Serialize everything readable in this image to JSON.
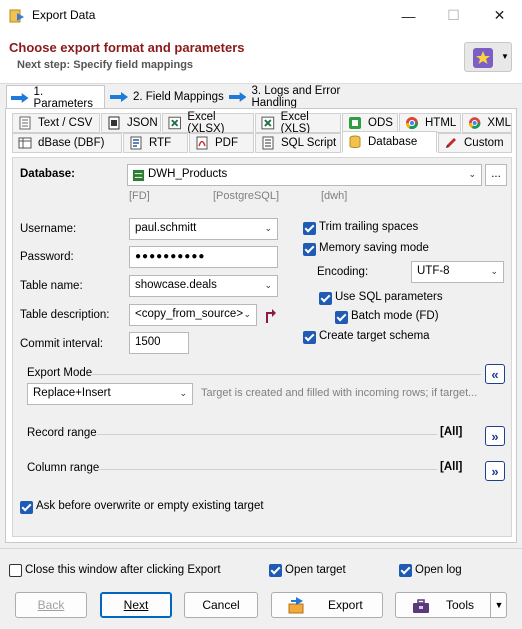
{
  "window": {
    "title": "Export Data"
  },
  "header": {
    "heading": "Choose export format and parameters",
    "next_step": "Next step: Specify field mappings"
  },
  "step_tabs": [
    {
      "label": "1. Parameters",
      "active": true
    },
    {
      "label": "2. Field Mappings",
      "active": false
    },
    {
      "label": "3. Logs and Error Handling",
      "active": false
    }
  ],
  "format_tabs": {
    "row1": [
      {
        "label": "Text / CSV",
        "icon": "text-file-icon"
      },
      {
        "label": "JSON",
        "icon": "json-icon"
      },
      {
        "label": "Excel (XLSX)",
        "icon": "excel-icon"
      },
      {
        "label": "Excel (XLS)",
        "icon": "excel-icon"
      },
      {
        "label": "ODS",
        "icon": "ods-icon"
      },
      {
        "label": "HTML",
        "icon": "chrome-icon"
      },
      {
        "label": "XML",
        "icon": "chrome-icon"
      }
    ],
    "row2": [
      {
        "label": "dBase (DBF)",
        "icon": "dbase-icon"
      },
      {
        "label": "RTF",
        "icon": "rtf-icon"
      },
      {
        "label": "PDF",
        "icon": "pdf-icon"
      },
      {
        "label": "SQL Script",
        "icon": "sql-icon"
      },
      {
        "label": "Database",
        "icon": "database-icon",
        "active": true
      },
      {
        "label": "Custom",
        "icon": "pencil-icon"
      }
    ]
  },
  "database": {
    "label": "Database:",
    "value": "DWH_Products",
    "browse": "...",
    "tags": [
      "[FD]",
      "[PostgreSQL]",
      "[dwh]"
    ]
  },
  "form": {
    "username_label": "Username:",
    "username": "paul.schmitt",
    "password_label": "Password:",
    "password": "●●●●●●●●●●",
    "table_name_label": "Table name:",
    "table_name": "showcase.deals",
    "table_desc_label": "Table description:",
    "table_desc": "<copy_from_source>",
    "commit_label": "Commit interval:",
    "commit": "1500"
  },
  "options": {
    "trim": "Trim trailing spaces",
    "memory": "Memory saving mode",
    "encoding_label": "Encoding:",
    "encoding": "UTF-8",
    "use_sql": "Use SQL parameters",
    "batch": "Batch mode (FD)",
    "create_schema": "Create target schema"
  },
  "export_mode": {
    "label": "Export Mode",
    "value": "Replace+Insert",
    "hint": "Target is created and filled with incoming rows; if target...",
    "collapse": "«"
  },
  "record_range": {
    "label": "Record range",
    "value": "[All]",
    "expand": "»"
  },
  "column_range": {
    "label": "Column range",
    "value": "[All]",
    "expand": "»"
  },
  "ask_overwrite": "Ask before overwrite or empty existing target",
  "footer": {
    "close_after": "Close this window after clicking Export",
    "open_target": "Open target",
    "open_log": "Open log",
    "back": "Back",
    "next": "Next",
    "cancel": "Cancel",
    "export": "Export",
    "tools": "Tools"
  }
}
